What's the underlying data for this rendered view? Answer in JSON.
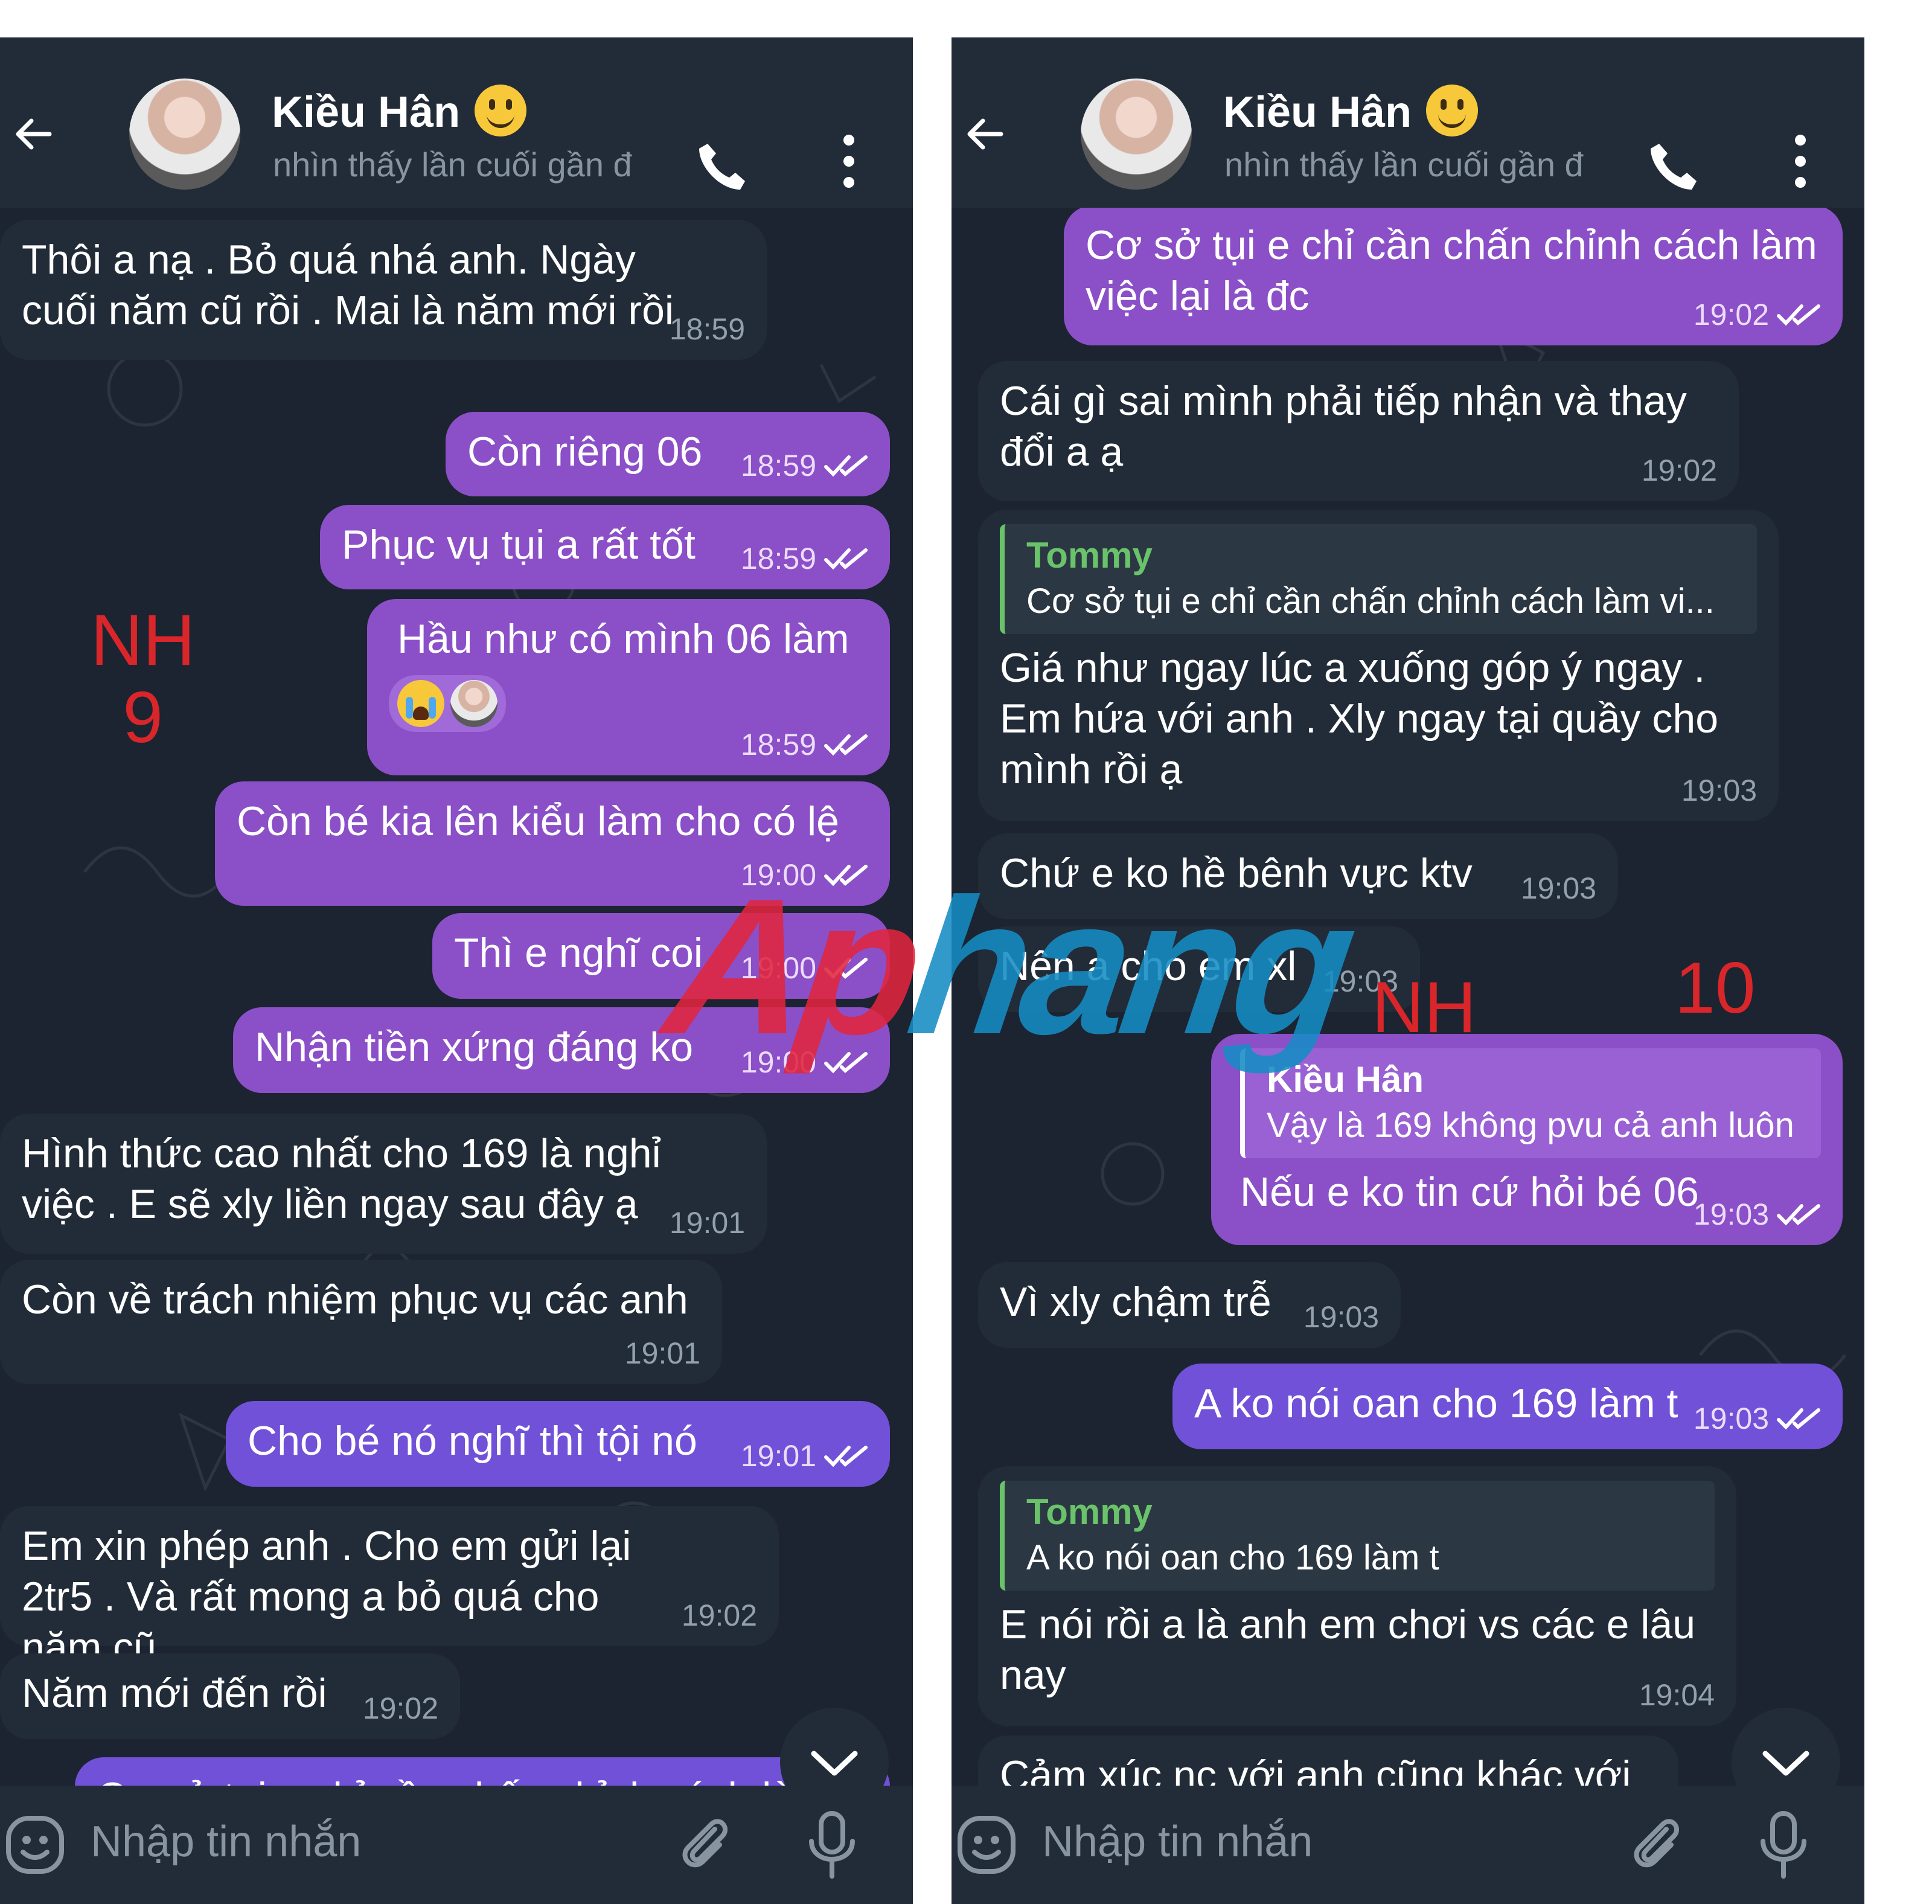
{
  "header": {
    "contact_name": "Kiều Hân",
    "status": "nhìn thấy lần cuối gần đ"
  },
  "left_chat": {
    "messages": [
      {
        "dir": "in",
        "text": "Thôi a nạ . Bỏ quá nhá anh. Ngày cuối năm cũ rồi . Mai là năm mới rồi",
        "time": "18:59"
      },
      {
        "dir": "out",
        "text": "Còn riêng 06",
        "time": "18:59"
      },
      {
        "dir": "out",
        "text": "Phục vụ tụi a rất tốt",
        "time": "18:59"
      },
      {
        "dir": "out",
        "text": "Hầu như có mình 06 làm",
        "time": "18:59"
      },
      {
        "dir": "out",
        "text": "Còn bé kia lên kiểu làm cho có lệ",
        "time": "19:00"
      },
      {
        "dir": "out",
        "text": "Thì e nghĩ coi",
        "time": "19:00"
      },
      {
        "dir": "out",
        "text": "Nhận tiền xứng đáng ko",
        "time": "19:00"
      },
      {
        "dir": "in",
        "text": "Hình thức cao nhất cho 169 là nghỉ việc . E sẽ xly liền ngay sau đây ạ",
        "time": "19:01"
      },
      {
        "dir": "in",
        "text": "Còn về trách nhiệm phục vụ các anh",
        "time": "19:01"
      },
      {
        "dir": "out",
        "text": "Cho bé nó nghĩ thì tội nó",
        "time": "19:01"
      },
      {
        "dir": "in",
        "text": "Em xin phép anh . Cho em gửi lại 2tr5 . Và rất mong a bỏ quá cho năm cũ",
        "time": "19:02"
      },
      {
        "dir": "in",
        "text": "Năm mới đến rồi",
        "time": "19:02"
      },
      {
        "dir": "out",
        "text": "Cơ sở tụi e chỉ cần chấn chỉnh cách làm",
        "time": ""
      }
    ]
  },
  "right_chat": {
    "messages": [
      {
        "dir": "out",
        "text": "Cơ sở tụi e chỉ cần chấn chỉnh cách làm việc lại là đc",
        "time": "19:02"
      },
      {
        "dir": "in",
        "text": "Cái gì sai mình phải tiếp nhận và thay đổi a ạ",
        "time": "19:02"
      },
      {
        "dir": "in",
        "quote_author": "Tommy",
        "quote_text": "Cơ sở tụi e chỉ cần chấn chỉnh cách làm vi...",
        "text": "Giá như ngay lúc a xuống góp ý ngay . Em hứa với anh . Xly ngay tại quầy cho mình rồi ạ",
        "time": "19:03"
      },
      {
        "dir": "in",
        "text": "Chứ e ko hề bênh vực ktv",
        "time": "19:03"
      },
      {
        "dir": "in",
        "text": "Nên a cho em xl",
        "time": "19:03"
      },
      {
        "dir": "out",
        "quote_author": "Kiều Hân",
        "quote_text": "Vậy là 169 không pvu cả anh luôn",
        "text": "Nếu e ko tin cứ hỏi bé 06",
        "time": "19:03"
      },
      {
        "dir": "in",
        "text": "Vì xly chậm trễ",
        "time": "19:03"
      },
      {
        "dir": "out",
        "text": "A ko nói oan cho 169 làm t",
        "time": "19:03"
      },
      {
        "dir": "in",
        "quote_author": "Tommy",
        "quote_text": "A ko nói oan cho 169 làm t",
        "text": "E nói rồi a là anh em chơi vs các e lâu nay",
        "time": "19:04"
      },
      {
        "dir": "in",
        "text": "Cảm xúc nc với anh cũng khác với",
        "time": ""
      }
    ]
  },
  "input": {
    "placeholder": "Nhập tin nhắn"
  },
  "annotations": {
    "left_label_1": "NH",
    "left_label_2": "9",
    "right_label_1": "NH",
    "right_label_2": "10"
  },
  "watermark": {
    "part1": "Ap",
    "part2": "hang"
  },
  "colors": {
    "chat_background": "#1b2430",
    "header_background": "#222c38",
    "incoming_bubble": "#222c38",
    "outgoing_bubble": "#8b4fc8",
    "quote_author_green": "#6ac36a",
    "annotation_red": "#d8262b"
  },
  "icons": [
    "back-arrow-icon",
    "phone-icon",
    "more-vertical-icon",
    "double-check-icon",
    "emoji-icon",
    "attach-icon",
    "microphone-icon",
    "chevron-down-icon"
  ]
}
